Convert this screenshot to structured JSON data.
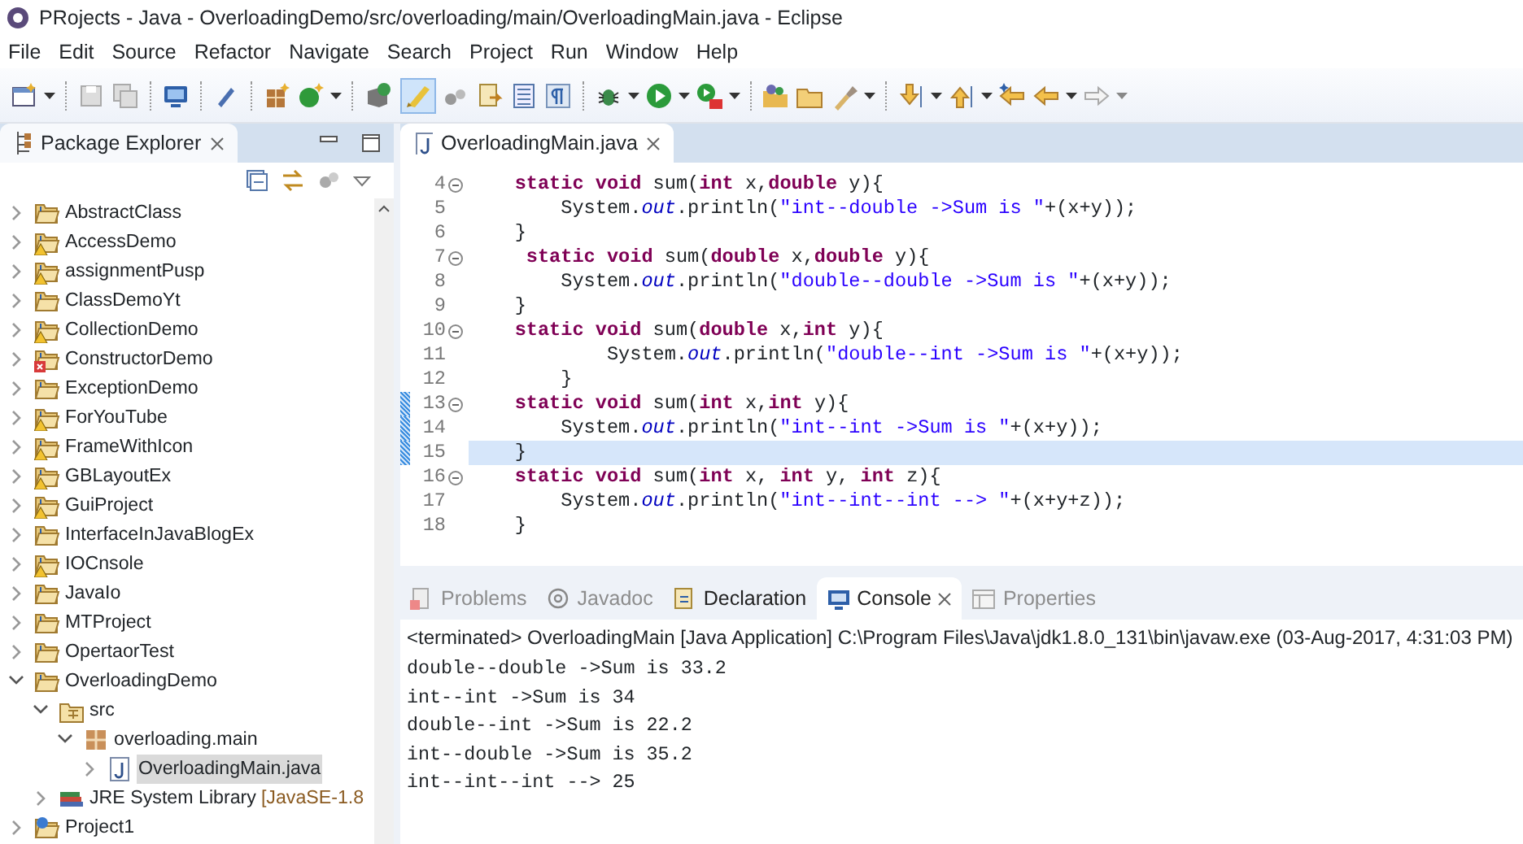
{
  "window": {
    "title": "PRojects - Java - OverloadingDemo/src/overloading/main/OverloadingMain.java - Eclipse"
  },
  "menu": [
    "File",
    "Edit",
    "Source",
    "Refactor",
    "Navigate",
    "Search",
    "Project",
    "Run",
    "Window",
    "Help"
  ],
  "package_explorer": {
    "title": "Package Explorer",
    "tree": [
      {
        "label": "AbstractClass",
        "kind": "project",
        "expanded": false,
        "selected": false
      },
      {
        "label": "AccessDemo",
        "kind": "project",
        "warning": true,
        "expanded": false,
        "selected": false
      },
      {
        "label": "assignmentPusp",
        "kind": "project",
        "warning": true,
        "expanded": false,
        "selected": false
      },
      {
        "label": "ClassDemoYt",
        "kind": "project",
        "expanded": false,
        "selected": false
      },
      {
        "label": "CollectionDemo",
        "kind": "project",
        "warning": true,
        "expanded": false,
        "selected": false
      },
      {
        "label": "ConstructorDemo",
        "kind": "project",
        "error": true,
        "expanded": false,
        "selected": false
      },
      {
        "label": "ExceptionDemo",
        "kind": "project",
        "expanded": false,
        "selected": false
      },
      {
        "label": "ForYouTube",
        "kind": "project",
        "warning": true,
        "expanded": false,
        "selected": false
      },
      {
        "label": "FrameWithIcon",
        "kind": "project",
        "warning": true,
        "expanded": false,
        "selected": false
      },
      {
        "label": "GBLayoutEx",
        "kind": "project",
        "warning": true,
        "expanded": false,
        "selected": false
      },
      {
        "label": "GuiProject",
        "kind": "project",
        "warning": true,
        "expanded": false,
        "selected": false
      },
      {
        "label": "InterfaceInJavaBlogEx",
        "kind": "project",
        "expanded": false,
        "selected": false
      },
      {
        "label": "IOCnsole",
        "kind": "project",
        "warning": true,
        "expanded": false,
        "selected": false
      },
      {
        "label": "JavaIo",
        "kind": "project",
        "expanded": false,
        "selected": false
      },
      {
        "label": "MTProject",
        "kind": "project",
        "expanded": false,
        "selected": false
      },
      {
        "label": "OpertaorTest",
        "kind": "project",
        "expanded": false,
        "selected": false
      },
      {
        "label": "OverloadingDemo",
        "kind": "project",
        "expanded": true,
        "selected": false,
        "children": [
          {
            "label": "src",
            "kind": "source-folder",
            "expanded": true,
            "selected": false,
            "children": [
              {
                "label": "overloading.main",
                "kind": "package",
                "expanded": true,
                "selected": false,
                "children": [
                  {
                    "label": "OverloadingMain.java",
                    "kind": "java-file",
                    "expanded": false,
                    "selected": true
                  }
                ]
              }
            ]
          },
          {
            "label": "JRE System Library",
            "suffix": "[JavaSE-1.8",
            "kind": "library",
            "expanded": false,
            "selected": false
          }
        ]
      },
      {
        "label": "Project1",
        "kind": "web-project",
        "expanded": false,
        "selected": false
      }
    ]
  },
  "editor": {
    "tab": "OverloadingMain.java",
    "lines": [
      {
        "number": "4",
        "foldable": true,
        "changed": false,
        "current": false,
        "tokens": [
          {
            "kind": "keyword",
            "text": "    static void"
          },
          {
            "kind": "plain",
            "text": " sum("
          },
          {
            "kind": "keyword",
            "text": "int"
          },
          {
            "kind": "plain",
            "text": " x,"
          },
          {
            "kind": "keyword",
            "text": "double"
          },
          {
            "kind": "plain",
            "text": " y){"
          }
        ]
      },
      {
        "number": "5",
        "foldable": false,
        "changed": false,
        "current": false,
        "tokens": [
          {
            "kind": "plain",
            "text": "        System."
          },
          {
            "kind": "field",
            "text": "out"
          },
          {
            "kind": "plain",
            "text": ".println("
          },
          {
            "kind": "string",
            "text": "\"int--double ->Sum is \""
          },
          {
            "kind": "plain",
            "text": "+(x+y));"
          }
        ]
      },
      {
        "number": "6",
        "foldable": false,
        "changed": false,
        "current": false,
        "tokens": [
          {
            "kind": "plain",
            "text": "    }"
          }
        ]
      },
      {
        "number": "7",
        "foldable": true,
        "changed": false,
        "current": false,
        "tokens": [
          {
            "kind": "keyword",
            "text": "     static void"
          },
          {
            "kind": "plain",
            "text": " sum("
          },
          {
            "kind": "keyword",
            "text": "double"
          },
          {
            "kind": "plain",
            "text": " x,"
          },
          {
            "kind": "keyword",
            "text": "double"
          },
          {
            "kind": "plain",
            "text": " y){"
          }
        ]
      },
      {
        "number": "8",
        "foldable": false,
        "changed": false,
        "current": false,
        "tokens": [
          {
            "kind": "plain",
            "text": "        System."
          },
          {
            "kind": "field",
            "text": "out"
          },
          {
            "kind": "plain",
            "text": ".println("
          },
          {
            "kind": "string",
            "text": "\"double--double ->Sum is \""
          },
          {
            "kind": "plain",
            "text": "+(x+y));"
          }
        ]
      },
      {
        "number": "9",
        "foldable": false,
        "changed": false,
        "current": false,
        "tokens": [
          {
            "kind": "plain",
            "text": "    }"
          }
        ]
      },
      {
        "number": "10",
        "foldable": true,
        "changed": false,
        "current": false,
        "tokens": [
          {
            "kind": "keyword",
            "text": "    static void"
          },
          {
            "kind": "plain",
            "text": " sum("
          },
          {
            "kind": "keyword",
            "text": "double"
          },
          {
            "kind": "plain",
            "text": " x,"
          },
          {
            "kind": "keyword",
            "text": "int"
          },
          {
            "kind": "plain",
            "text": " y){"
          }
        ]
      },
      {
        "number": "11",
        "foldable": false,
        "changed": false,
        "current": false,
        "tokens": [
          {
            "kind": "plain",
            "text": "            System."
          },
          {
            "kind": "field",
            "text": "out"
          },
          {
            "kind": "plain",
            "text": ".println("
          },
          {
            "kind": "string",
            "text": "\"double--int ->Sum is \""
          },
          {
            "kind": "plain",
            "text": "+(x+y));"
          }
        ]
      },
      {
        "number": "12",
        "foldable": false,
        "changed": false,
        "current": false,
        "tokens": [
          {
            "kind": "plain",
            "text": "        }"
          }
        ]
      },
      {
        "number": "13",
        "foldable": true,
        "changed": true,
        "current": false,
        "tokens": [
          {
            "kind": "keyword",
            "text": "    static void"
          },
          {
            "kind": "plain",
            "text": " sum("
          },
          {
            "kind": "keyword",
            "text": "int"
          },
          {
            "kind": "plain",
            "text": " x,"
          },
          {
            "kind": "keyword",
            "text": "int"
          },
          {
            "kind": "plain",
            "text": " y){"
          }
        ]
      },
      {
        "number": "14",
        "foldable": false,
        "changed": true,
        "current": false,
        "tokens": [
          {
            "kind": "plain",
            "text": "        System."
          },
          {
            "kind": "field",
            "text": "out"
          },
          {
            "kind": "plain",
            "text": ".println("
          },
          {
            "kind": "string",
            "text": "\"int--int ->Sum is \""
          },
          {
            "kind": "plain",
            "text": "+(x+y));"
          }
        ]
      },
      {
        "number": "15",
        "foldable": false,
        "changed": true,
        "current": true,
        "tokens": [
          {
            "kind": "plain",
            "text": "    }"
          }
        ]
      },
      {
        "number": "16",
        "foldable": true,
        "changed": false,
        "current": false,
        "tokens": [
          {
            "kind": "keyword",
            "text": "    static void"
          },
          {
            "kind": "plain",
            "text": " sum("
          },
          {
            "kind": "keyword",
            "text": "int"
          },
          {
            "kind": "plain",
            "text": " x, "
          },
          {
            "kind": "keyword",
            "text": "int"
          },
          {
            "kind": "plain",
            "text": " y, "
          },
          {
            "kind": "keyword",
            "text": "int"
          },
          {
            "kind": "plain",
            "text": " z){"
          }
        ]
      },
      {
        "number": "17",
        "foldable": false,
        "changed": false,
        "current": false,
        "tokens": [
          {
            "kind": "plain",
            "text": "        System."
          },
          {
            "kind": "field",
            "text": "out"
          },
          {
            "kind": "plain",
            "text": ".println("
          },
          {
            "kind": "string",
            "text": "\"int--int--int --> \""
          },
          {
            "kind": "plain",
            "text": "+(x+y+z));"
          }
        ]
      },
      {
        "number": "18",
        "foldable": false,
        "changed": false,
        "current": false,
        "tokens": [
          {
            "kind": "plain",
            "text": "    }"
          }
        ]
      }
    ]
  },
  "bottom_tabs": [
    {
      "label": "Problems",
      "kind": "problems",
      "selected": false,
      "disabled": true
    },
    {
      "label": "Javadoc",
      "kind": "javadoc",
      "selected": false,
      "disabled": true
    },
    {
      "label": "Declaration",
      "kind": "declaration",
      "selected": false,
      "disabled": false
    },
    {
      "label": "Console",
      "kind": "console",
      "selected": true,
      "disabled": false
    },
    {
      "label": "Properties",
      "kind": "properties",
      "selected": false,
      "disabled": true
    }
  ],
  "console": {
    "header": "<terminated> OverloadingMain [Java Application] C:\\Program Files\\Java\\jdk1.8.0_131\\bin\\javaw.exe (03-Aug-2017, 4:31:03 PM)",
    "output": [
      "double--double ->Sum is 33.2",
      "int--int ->Sum is 34",
      "double--int ->Sum is 22.2",
      "int--double ->Sum is 35.2",
      "int--int--int --> 25"
    ]
  }
}
